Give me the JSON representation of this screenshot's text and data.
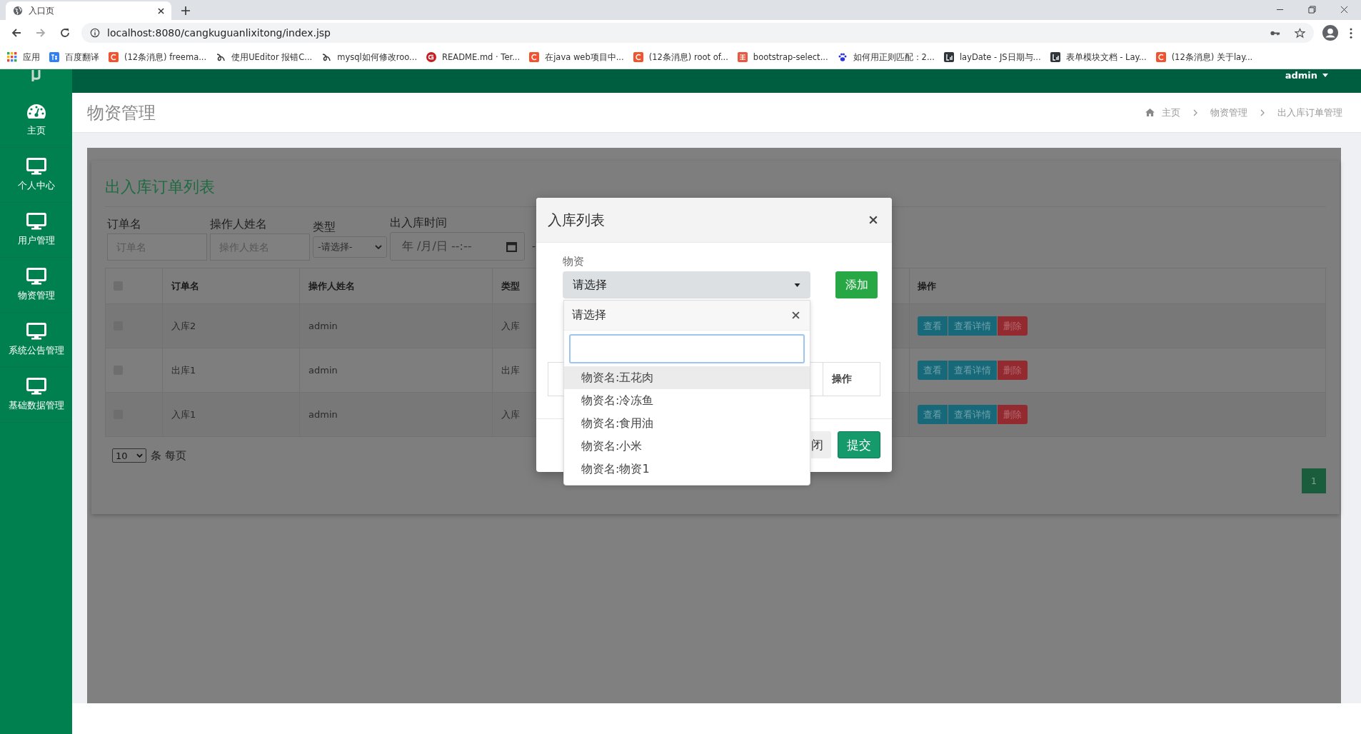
{
  "browser": {
    "tab": {
      "title": "入口页"
    },
    "url": "localhost:8080/cangkuguanlixitong/index.jsp",
    "bookmarks": [
      {
        "kind": "apps",
        "label": "应用"
      },
      {
        "kind": "translate",
        "label": "百度翻译"
      },
      {
        "kind": "csdn",
        "label": "(12条消息) freema..."
      },
      {
        "kind": "swirl",
        "label": "使用UEditor 报错C..."
      },
      {
        "kind": "swirl",
        "label": "mysql如何修改roo..."
      },
      {
        "kind": "gitee",
        "label": "README.md · Ter..."
      },
      {
        "kind": "csdn",
        "label": "在java web项目中..."
      },
      {
        "kind": "csdn",
        "label": "(12条消息) root of..."
      },
      {
        "kind": "jian",
        "label": "bootstrap-select..."
      },
      {
        "kind": "paw",
        "label": "如何用正则匹配：2..."
      },
      {
        "kind": "layui",
        "label": "layDate - JS日期与..."
      },
      {
        "kind": "layui",
        "label": "表单模块文档 - Lay..."
      },
      {
        "kind": "csdn",
        "label": "(12条消息) 关于lay..."
      }
    ]
  },
  "sidebar": {
    "items": [
      {
        "kind": "dashboard",
        "label": "主页"
      },
      {
        "kind": "monitor",
        "label": "个人中心"
      },
      {
        "kind": "monitor",
        "label": "用户管理"
      },
      {
        "kind": "monitor",
        "label": "物资管理"
      },
      {
        "kind": "monitor",
        "label": "系统公告管理"
      },
      {
        "kind": "monitor",
        "label": "基础数据管理"
      }
    ]
  },
  "header": {
    "user": "admin"
  },
  "page": {
    "title": "物资管理",
    "breadcrumbs": [
      "主页",
      "物资管理",
      "出入库订单管理"
    ]
  },
  "card": {
    "title": "出入库订单列表",
    "filters": [
      {
        "kind": "text",
        "label": "订单名",
        "placeholder": "订单名"
      },
      {
        "kind": "text",
        "label": "操作人姓名",
        "placeholder": "操作人姓名"
      },
      {
        "kind": "select",
        "label": "类型",
        "value": "-请选择-"
      },
      {
        "kind": "datetime",
        "label": "出入库时间",
        "value": "年 /月/日 --:--"
      }
    ],
    "range_dash": "-",
    "table": {
      "select_all": {
        "checked": false
      },
      "columns": [
        "订单名",
        "操作人姓名",
        "类型",
        "操作"
      ],
      "rows": [
        {
          "checked": false,
          "cells": [
            "入库2",
            "admin",
            "入库"
          ],
          "actions": [
            {
              "kind": "info",
              "label": "查看"
            },
            {
              "kind": "info",
              "label": "查看详情"
            },
            {
              "kind": "danger",
              "label": "删除"
            }
          ]
        },
        {
          "checked": false,
          "cells": [
            "出库1",
            "admin",
            "出库"
          ],
          "actions": [
            {
              "kind": "info",
              "label": "查看"
            },
            {
              "kind": "info",
              "label": "查看详情"
            },
            {
              "kind": "danger",
              "label": "删除"
            }
          ]
        },
        {
          "checked": false,
          "cells": [
            "入库1",
            "admin",
            "入库"
          ],
          "actions": [
            {
              "kind": "info",
              "label": "查看"
            },
            {
              "kind": "info",
              "label": "查看详情"
            },
            {
              "kind": "danger",
              "label": "删除"
            }
          ]
        }
      ]
    },
    "page_size": "10",
    "page_size_label": "条 每页",
    "pages": [
      {
        "label": "1",
        "selected": true
      }
    ]
  },
  "modal": {
    "title": "入库列表",
    "field_label": "物资",
    "select_value": "请选择",
    "add_button": "添加",
    "table_column": "操作",
    "buttons": [
      {
        "kind": "default",
        "label": "闭"
      },
      {
        "kind": "primary",
        "label": "提交"
      }
    ],
    "dropdown": {
      "title": "请选择",
      "options": [
        {
          "label": "物资名:五花肉",
          "selected": true
        },
        {
          "label": "物资名:冷冻鱼",
          "selected": false
        },
        {
          "label": "物资名:食用油",
          "selected": false
        },
        {
          "label": "物资名:小米",
          "selected": false
        },
        {
          "label": "物资名:物资1",
          "selected": false
        }
      ]
    }
  }
}
